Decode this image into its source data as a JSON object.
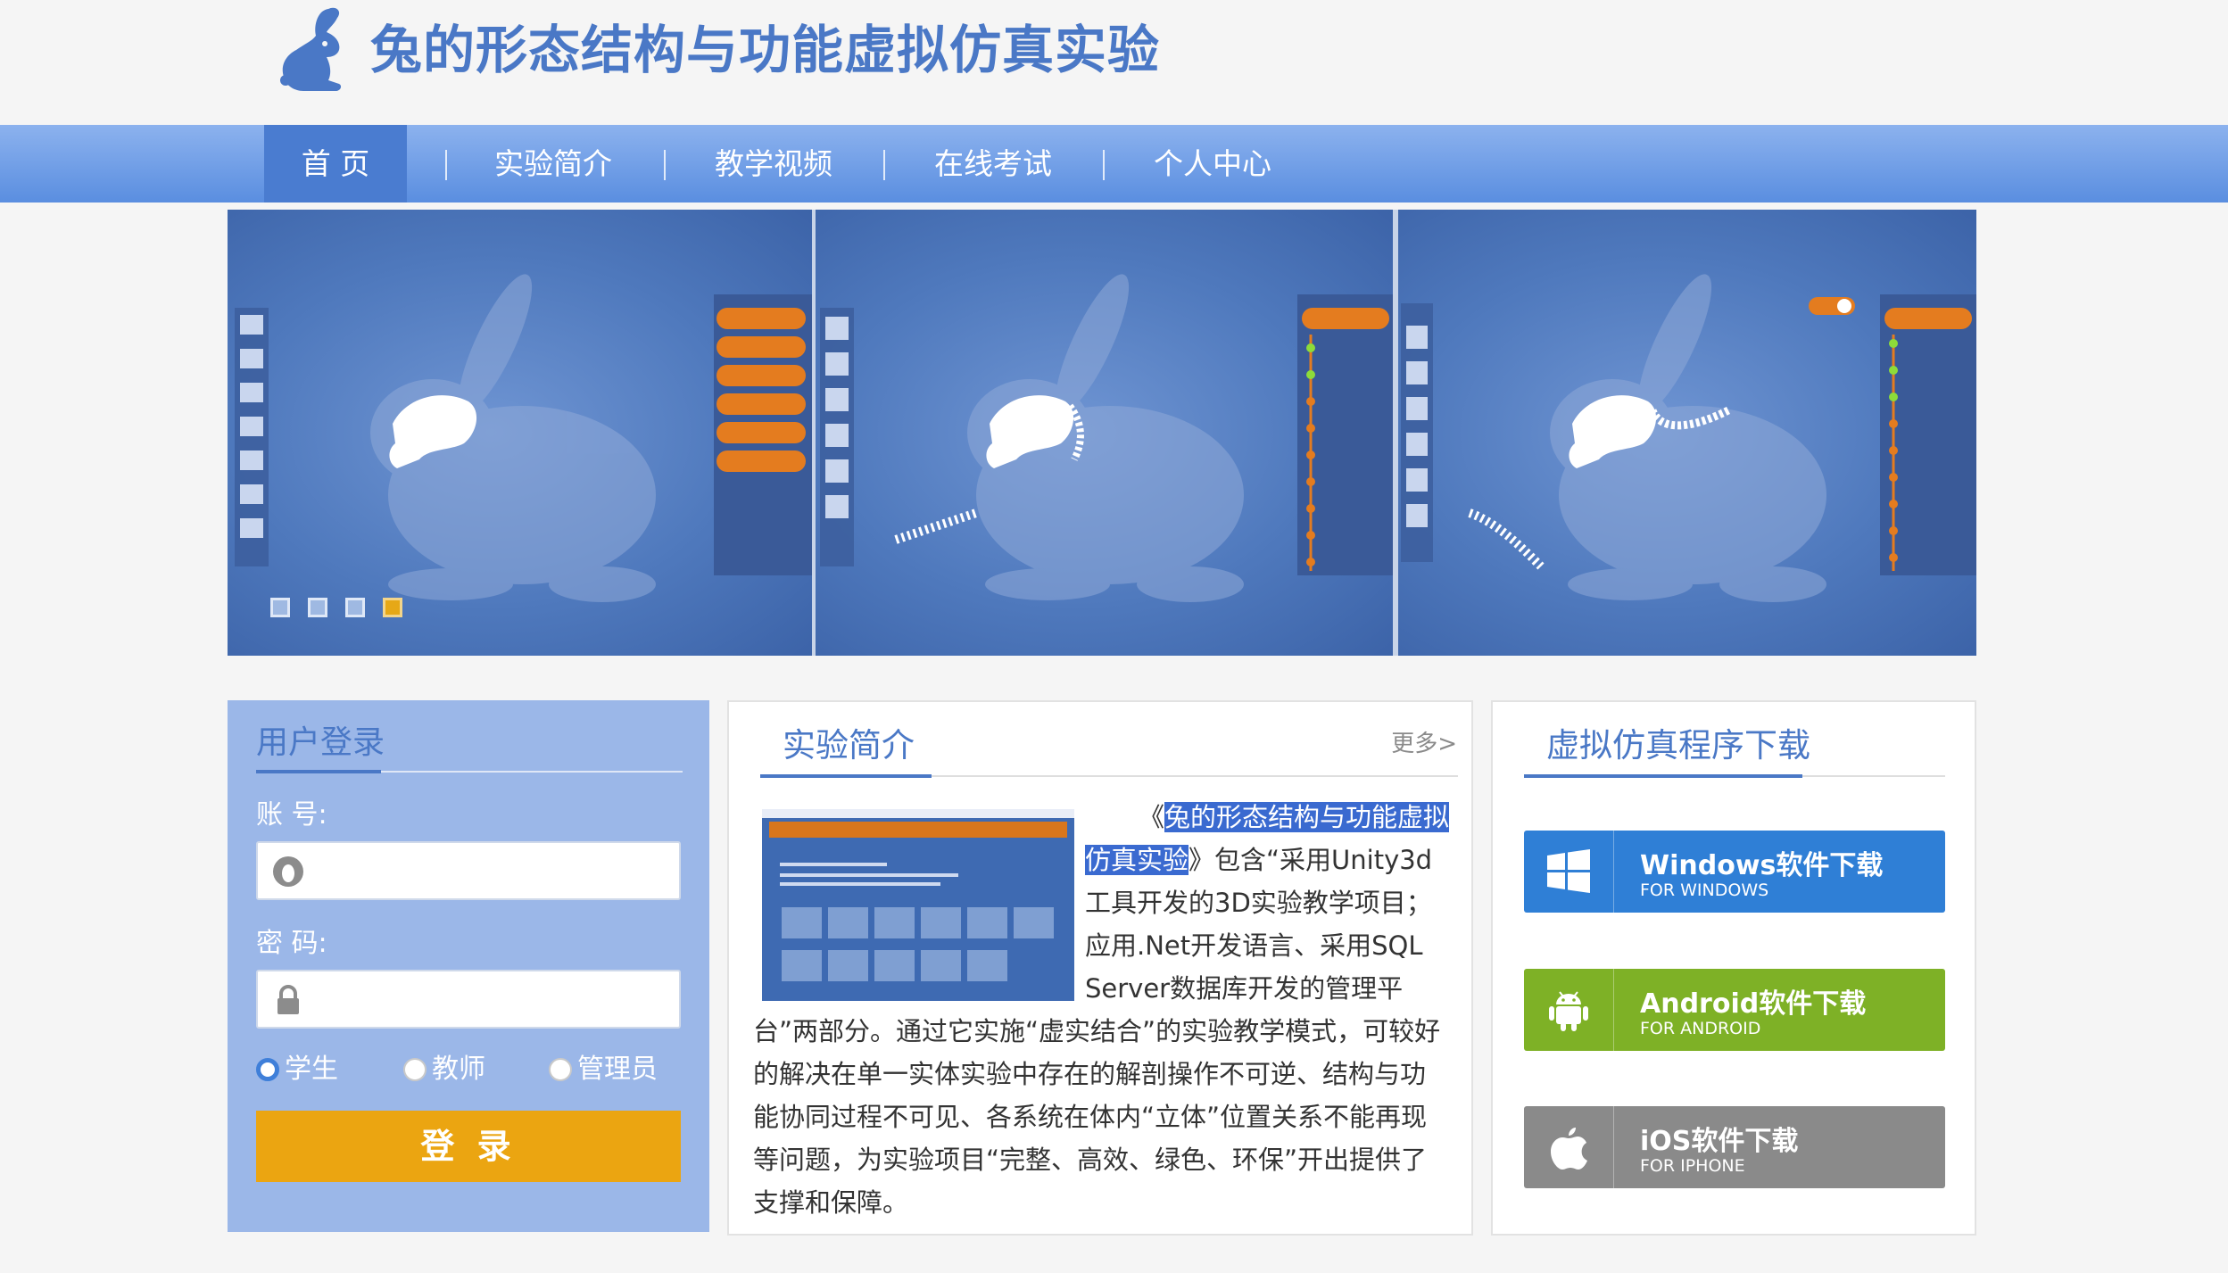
{
  "header": {
    "title": "兔的形态结构与功能虚拟仿真实验"
  },
  "nav": {
    "items": [
      {
        "label": "首 页",
        "active": true
      },
      {
        "label": "实验简介",
        "active": false
      },
      {
        "label": "教学视频",
        "active": false
      },
      {
        "label": "在线考试",
        "active": false
      },
      {
        "label": "个人中心",
        "active": false
      }
    ]
  },
  "banner": {
    "active_slide": 4,
    "slide_count": 4
  },
  "login": {
    "title": "用户登录",
    "account_label": "账 号:",
    "password_label": "密 码:",
    "account_value": "",
    "password_value": "",
    "roles": [
      {
        "label": "学生",
        "checked": true
      },
      {
        "label": "教师",
        "checked": false
      },
      {
        "label": "管理员",
        "checked": false
      }
    ],
    "submit_label": "登 录"
  },
  "intro": {
    "title": "实验简介",
    "more": "更多>",
    "text_open": "《",
    "text_highlight": "兔的形态结构与功能虚拟仿真实验",
    "text_body": "》包含“采用Unity3d工具开发的3D实验教学项目；应用.Net开发语言、采用SQL Server数据库开发的管理平台”两部分。通过它实施“虚实结合”的实验教学模式，可较好的解决在单一实体实验中存在的解剖操作不可逆、结构与功能协同过程不可见、各系统在体内“立体”位置关系不能再现等问题，为实验项目“完整、高效、绿色、环保”开出提供了支撑和保障。"
  },
  "download": {
    "title": "虚拟仿真程序下载",
    "buttons": [
      {
        "label": "Windows软件下载",
        "sub": "FOR WINDOWS",
        "color": "#2f7fd6",
        "icon": "windows-icon"
      },
      {
        "label": "Android软件下载",
        "sub": "FOR ANDROID",
        "color": "#7eb126",
        "icon": "android-icon"
      },
      {
        "label": "iOS软件下载",
        "sub": "FOR IPHONE",
        "color": "#8a8a8a",
        "icon": "apple-icon"
      }
    ]
  },
  "colors": {
    "brand": "#4a78c6",
    "nav": "#6d9ae5",
    "accent": "#eba511"
  }
}
